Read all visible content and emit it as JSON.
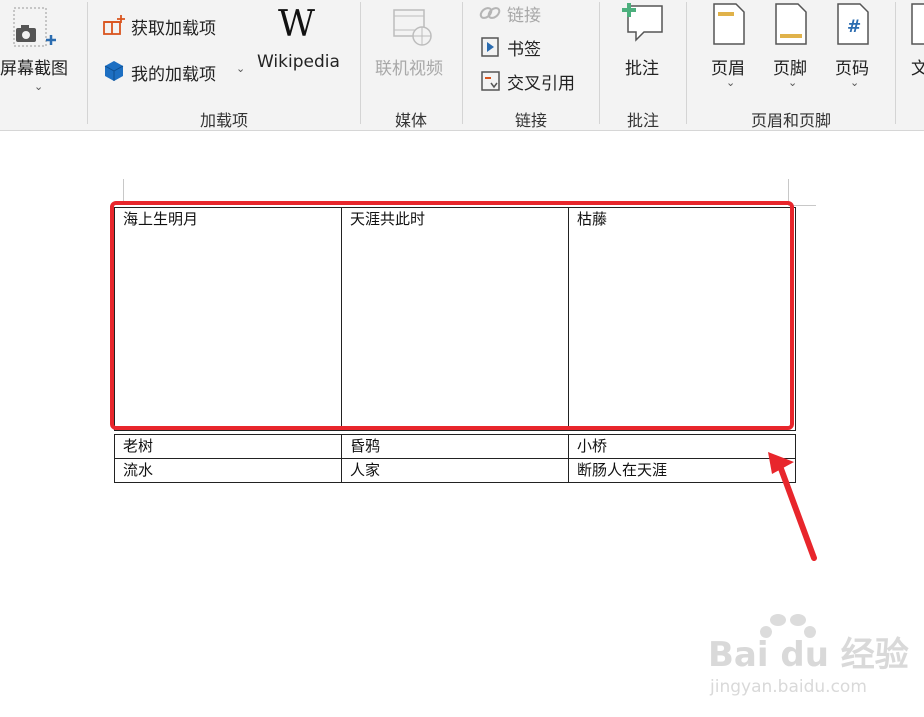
{
  "ribbon": {
    "screenshot": {
      "label": "屏幕截图"
    },
    "addins": {
      "get_label": "获取加载项",
      "my_label": "我的加载项",
      "wikipedia_label": "Wikipedia",
      "group_label": "加载项"
    },
    "media": {
      "online_video_label": "联机视频",
      "group_label": "媒体"
    },
    "links": {
      "link_label": "链接",
      "bookmark_label": "书签",
      "crossref_label": "交叉引用",
      "group_label": "链接"
    },
    "comments": {
      "comment_label": "批注",
      "group_label": "批注"
    },
    "header_footer": {
      "header_label": "页眉",
      "footer_label": "页脚",
      "page_number_label": "页码",
      "page_number_glyph": "#",
      "group_label": "页眉和页脚"
    },
    "text_partial": "文",
    "wikipedia_glyph": "W"
  },
  "document": {
    "table_top": {
      "cells": [
        "海上生明月",
        "天涯共此时",
        "枯藤"
      ]
    },
    "table_bottom": {
      "rows": [
        [
          "老树",
          "昏鸦",
          "小桥"
        ],
        [
          "流水",
          "人家",
          "断肠人在天涯"
        ]
      ]
    }
  },
  "watermark": {
    "text": "Bai du 经验",
    "url": "jingyan.baidu.com"
  },
  "colors": {
    "highlight": "#e8262c",
    "accent_blue": "#2b6cb0",
    "accent_green": "#4caf7d"
  }
}
